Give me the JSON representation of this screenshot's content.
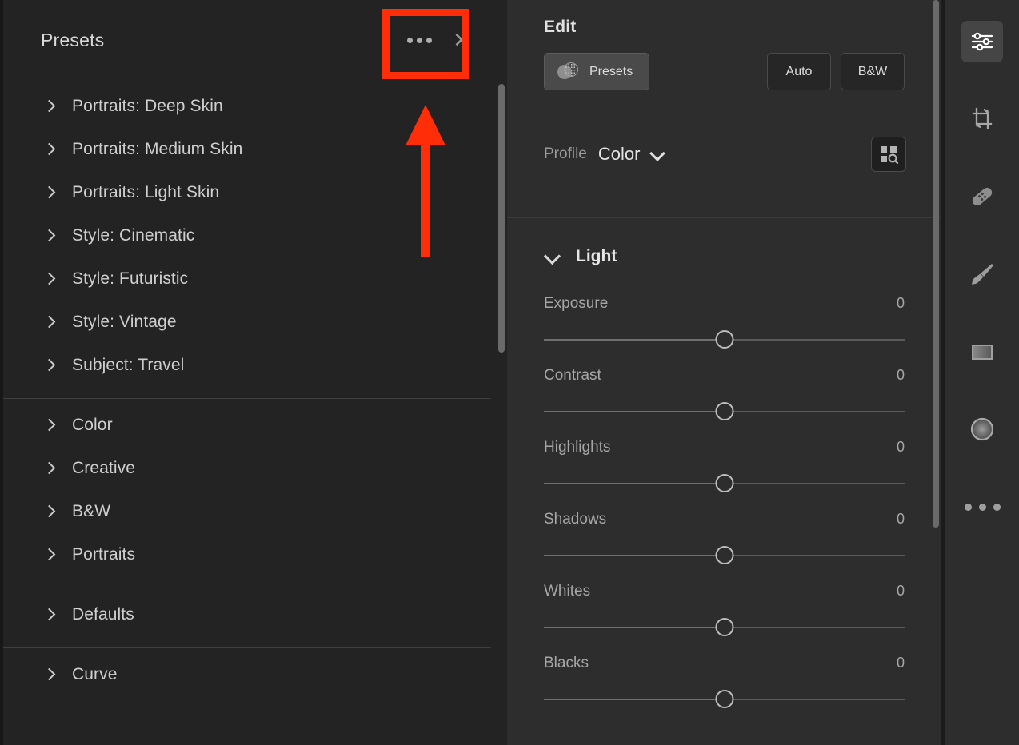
{
  "presets_panel": {
    "title": "Presets",
    "more_button": "more-options",
    "close_button": "✕",
    "groups": [
      {
        "items": [
          {
            "label": "Portraits: Deep Skin"
          },
          {
            "label": "Portraits: Medium Skin"
          },
          {
            "label": "Portraits: Light Skin"
          },
          {
            "label": "Style: Cinematic"
          },
          {
            "label": "Style: Futuristic"
          },
          {
            "label": "Style: Vintage"
          },
          {
            "label": "Subject: Travel"
          }
        ]
      },
      {
        "items": [
          {
            "label": "Color"
          },
          {
            "label": "Creative"
          },
          {
            "label": "B&W"
          },
          {
            "label": "Portraits"
          }
        ]
      },
      {
        "items": [
          {
            "label": "Defaults"
          }
        ]
      },
      {
        "items": [
          {
            "label": "Curve"
          }
        ]
      }
    ]
  },
  "edit_panel": {
    "title": "Edit",
    "presets_button": "Presets",
    "auto_button": "Auto",
    "bw_button": "B&W",
    "profile": {
      "label": "Profile",
      "value": "Color",
      "browse_tooltip": "Browse Profiles"
    },
    "light_section": {
      "title": "Light",
      "sliders": [
        {
          "name": "Exposure",
          "value": "0"
        },
        {
          "name": "Contrast",
          "value": "0"
        },
        {
          "name": "Highlights",
          "value": "0"
        },
        {
          "name": "Shadows",
          "value": "0"
        },
        {
          "name": "Whites",
          "value": "0"
        },
        {
          "name": "Blacks",
          "value": "0"
        }
      ]
    }
  },
  "tool_rail": {
    "tools": [
      {
        "name": "edit-sliders-tool",
        "active": true
      },
      {
        "name": "crop-rotate-tool",
        "active": false
      },
      {
        "name": "healing-brush-tool",
        "active": false
      },
      {
        "name": "masking-brush-tool",
        "active": false
      },
      {
        "name": "linear-gradient-tool",
        "active": false
      },
      {
        "name": "radial-gradient-tool",
        "active": false
      },
      {
        "name": "more-tools",
        "active": false
      }
    ]
  },
  "annotation": {
    "highlight_color": "#ff2d08",
    "target": "presets-more-options-button"
  }
}
